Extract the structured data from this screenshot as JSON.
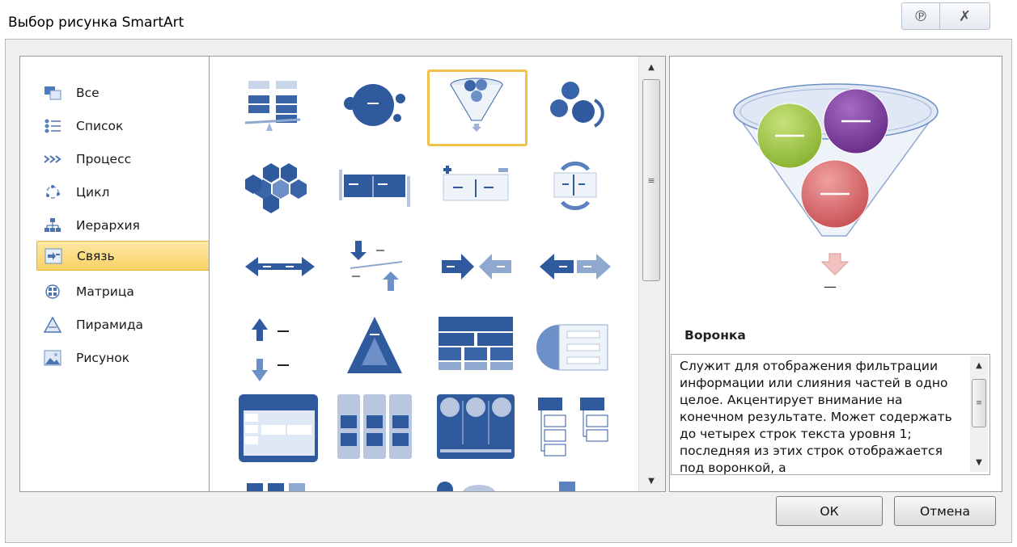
{
  "dialog": {
    "title": "Выбор рисунка SmartArt",
    "help_icon_name": "help-icon",
    "close_icon_name": "close-icon"
  },
  "categories": [
    {
      "label": "Все",
      "icon": "all-icon",
      "selected": false
    },
    {
      "label": "Список",
      "icon": "list-icon",
      "selected": false
    },
    {
      "label": "Процесс",
      "icon": "process-icon",
      "selected": false
    },
    {
      "label": "Цикл",
      "icon": "cycle-icon",
      "selected": false
    },
    {
      "label": "Иерархия",
      "icon": "hierarchy-icon",
      "selected": false
    },
    {
      "label": "Связь",
      "icon": "relationship-icon",
      "selected": true
    },
    {
      "label": "Матрица",
      "icon": "matrix-icon",
      "selected": false
    },
    {
      "label": "Пирамида",
      "icon": "pyramid-icon",
      "selected": false
    },
    {
      "label": "Рисунок",
      "icon": "picture-icon",
      "selected": false
    }
  ],
  "gallery": {
    "selected_index": 2
  },
  "preview": {
    "title": "Воронка",
    "description": "Служит для отображения фильтрации информации или слияния частей в одно целое. Акцентирует внимание на конечном результате. Может содержать до четырех строк текста уровня 1; последняя из этих строк отображается под воронкой, а",
    "label": "—"
  },
  "buttons": {
    "ok": "ОК",
    "cancel": "Отмена"
  },
  "colors": {
    "accent_blue": "#3a64a8",
    "selection_yellow": "#f0c24a",
    "green": "#8fbf3a",
    "purple": "#7a3d9a",
    "red": "#d9686a"
  }
}
